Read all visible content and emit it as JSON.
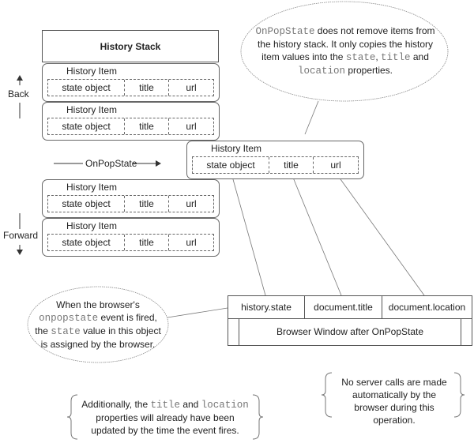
{
  "history_stack": {
    "title": "History Stack",
    "items": [
      {
        "label": "History Item",
        "fields": [
          "state object",
          "title",
          "url"
        ]
      },
      {
        "label": "History Item",
        "fields": [
          "state object",
          "title",
          "url"
        ]
      },
      {
        "label": "History Item",
        "fields": [
          "state object",
          "title",
          "url"
        ]
      },
      {
        "label": "History Item",
        "fields": [
          "state object",
          "title",
          "url"
        ]
      }
    ]
  },
  "popped_item": {
    "label": "History Item",
    "fields": [
      "state object",
      "title",
      "url"
    ]
  },
  "arrows": {
    "back": "Back",
    "forward": "Forward",
    "onpopstate": "OnPopState"
  },
  "browser_window": {
    "properties": [
      "history.state",
      "document.title",
      "document.location"
    ],
    "caption": "Browser Window after OnPopState"
  },
  "callouts": {
    "top": {
      "code1": "OnPopState",
      "text1": " does not remove items from the history stack. It only copies the history item values into the ",
      "code2": "state",
      "text2": ", ",
      "code3": "title",
      "text3": " and ",
      "code4": "location",
      "text4": " properties."
    },
    "bottom_left": {
      "text1": "When the browser's ",
      "code1": "onpopstate",
      "text2": " event is fired, the ",
      "code2": "state",
      "text3": " value in this object is assigned by the browser."
    }
  },
  "notes": {
    "additional": {
      "text1": "Additionally, the ",
      "code1": "title",
      "text2": " and ",
      "code2": "location",
      "text3": " properties will already have been updated by the time the event fires."
    },
    "server": "No server calls are made automatically by the browser during this operation."
  },
  "colors": {
    "line": "#666666",
    "code": "#777777",
    "text": "#222222"
  }
}
